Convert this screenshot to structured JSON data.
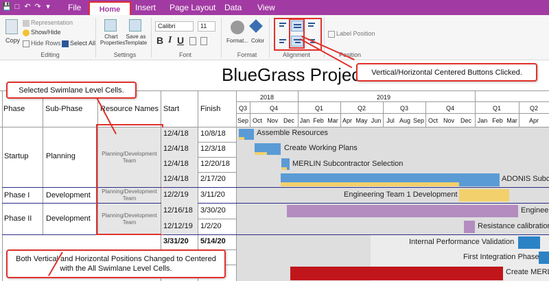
{
  "menu": {
    "file": "File",
    "home": "Home",
    "insert": "Insert",
    "page_layout": "Page Layout",
    "data": "Data",
    "view": "View"
  },
  "ribbon": {
    "copy": "Copy",
    "representation": "Representation",
    "show_hide": "Show/Hide",
    "hide_rows": "Hide Rows",
    "select_all": "Select All",
    "editing": "Editing",
    "chart_properties_1": "Chart",
    "chart_properties_2": "Properties",
    "save_template_1": "Save as",
    "save_template_2": "Template",
    "settings": "Settings",
    "font_name": "Calibri",
    "font_size": "11",
    "bold": "B",
    "italic": "I",
    "underline": "U",
    "font": "Font",
    "format": "Format...",
    "color": "Color",
    "format_group": "Format",
    "alignment": "Alignment",
    "label_position": "Label Position",
    "position": "Position"
  },
  "gantt": {
    "title": "BlueGrass Project",
    "headers": {
      "phase": "Phase",
      "subphase": "Sub-Phase",
      "resource": "Resource Names",
      "start": "Start",
      "finish": "Finish"
    },
    "years": [
      "2018",
      "2019"
    ],
    "quarters": [
      "Q3",
      "Q4",
      "Q1",
      "Q2",
      "Q3",
      "Q4",
      "Q1",
      "Q2"
    ],
    "months": [
      "Sep",
      "Oct",
      "Nov",
      "Dec",
      "Jan",
      "Feb",
      "Mar",
      "Apr",
      "May",
      "Jun",
      "Jul",
      "Aug",
      "Sep",
      "Oct",
      "Nov",
      "Dec",
      "Jan",
      "Feb",
      "Mar",
      "Apr"
    ],
    "phases": {
      "startup": "Startup",
      "phase1": "Phase I",
      "phase2": "Phase II",
      "planning": "Planning",
      "development1": "Development",
      "development2": "Development"
    },
    "resources": {
      "r1": "Planning/Development Team",
      "r2": "Planning/Development Team",
      "r3": "Planning/Development Team"
    },
    "rows": [
      {
        "start": "12/4/18",
        "finish": "10/8/18",
        "task": "Assemble Resources"
      },
      {
        "start": "12/4/18",
        "finish": "12/3/18",
        "task": "Create Working Plans"
      },
      {
        "start": "12/4/18",
        "finish": "12/20/18",
        "task": "MERLIN Subcontractor Selection"
      },
      {
        "start": "12/4/18",
        "finish": "2/17/20",
        "task": "ADONIS Subco"
      },
      {
        "start": "12/2/19",
        "finish": "3/11/20",
        "task": "Engineering Team 1 Development"
      },
      {
        "start": "12/16/18",
        "finish": "3/30/20",
        "task": "Engineer"
      },
      {
        "start": "12/12/19",
        "finish": "1/2/20",
        "task": "Resistance calibration"
      },
      {
        "start": "3/31/20",
        "finish": "5/14/20",
        "task": "Internal Performance Validation"
      },
      {
        "start": "",
        "finish": "",
        "task": "First Integration Phase"
      },
      {
        "start": "",
        "finish": "",
        "task": "Create MERL"
      }
    ]
  },
  "callouts": {
    "top": "Vertical/Horizontal Centered Buttons Clicked.",
    "left": "Selected Swimlane Level Cells.",
    "bottom": "Both Vertical and Horizontal Positions Changed to Centered with the All Swimlane Level Cells."
  },
  "colors": {
    "titlebar": "#a23aa3",
    "bar_blue": "#5b9bd5",
    "bar_yellow": "#f2d06b",
    "bar_purple": "#b48cc0",
    "bar_red": "#c0161b",
    "callout_border": "#e0312b"
  }
}
